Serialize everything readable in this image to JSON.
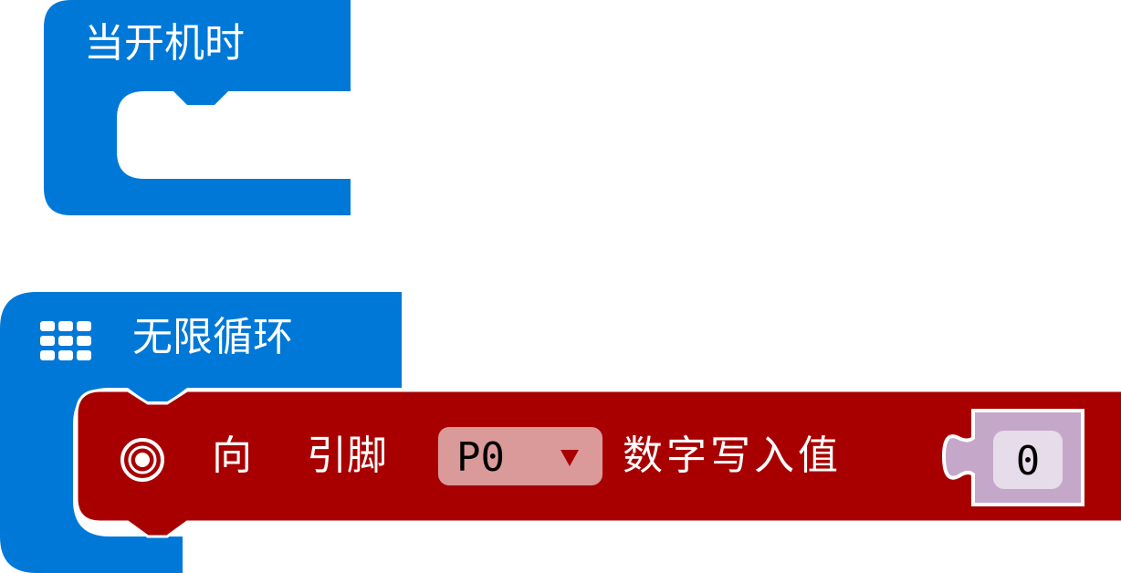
{
  "blocks": {
    "on_start": {
      "label": "当开机时",
      "color": "#0078d7"
    },
    "forever": {
      "label": "无限循环",
      "icon": "grid-icon",
      "color": "#0078d7"
    },
    "digital_write": {
      "prefix": "向",
      "pin_label": "引脚",
      "pin_value": "P0",
      "suffix": "数字写入值",
      "value": "0",
      "icon": "target-icon",
      "color": "#a80000",
      "value_block_color": "#c5a8c9"
    }
  }
}
